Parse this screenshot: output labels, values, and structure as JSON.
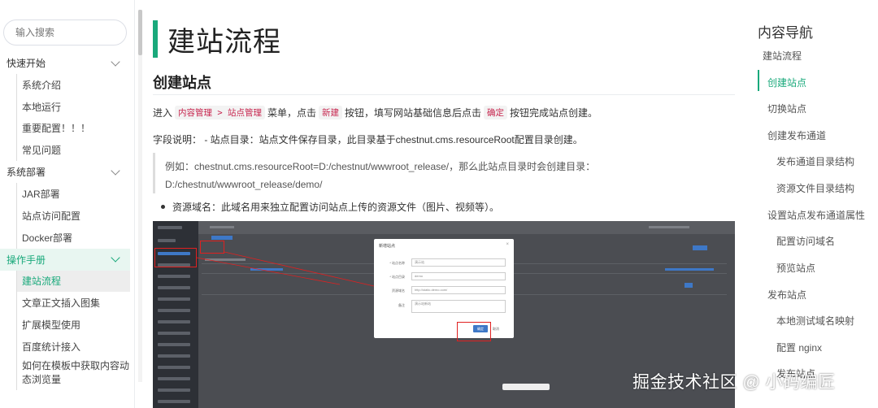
{
  "sidebar": {
    "search_placeholder": "输入搜索",
    "groups": [
      {
        "label": "快速开始",
        "items": [
          "系统介绍",
          "本地运行",
          "重要配置！！！",
          "常见问题"
        ]
      },
      {
        "label": "系统部署",
        "items": [
          "JAR部署",
          "站点访问配置",
          "Docker部署"
        ]
      },
      {
        "label": "操作手册",
        "items": [
          "建站流程",
          "文章正文插入图集",
          "扩展模型使用",
          "百度统计接入",
          "如何在模板中获取内容动态浏览量"
        ]
      }
    ]
  },
  "main": {
    "title": "建站流程",
    "section_title": "创建站点",
    "para1": {
      "pre": "进入",
      "code1": "内容管理 > 站点管理",
      "mid1": "菜单，点击",
      "code2": "新建",
      "mid2": "按钮，填写网站基础信息后点击",
      "code3": "确定",
      "post": "按钮完成站点创建。"
    },
    "para2": "字段说明： - 站点目录：站点文件保存目录，此目录基于chestnut.cms.resourceRoot配置目录创建。",
    "quote": "例如：chestnut.cms.resourceRoot=D:/chestnut/wwwroot_release/，那么此站点目录时会创建目录：D:/chestnut/wwwroot_release/demo/",
    "bullet": "资源域名：此域名用来独立配置访问站点上传的资源文件（图片、视频等）。",
    "screenshot": {
      "dialog_title": "新增站点",
      "fields": [
        {
          "label": "* 站点名称",
          "value": "演示站"
        },
        {
          "label": "* 站点目录",
          "value": "demo"
        },
        {
          "label": "资源域名",
          "value": "http://static.demo.com/"
        },
        {
          "label": "备注",
          "value": "演示站新站"
        }
      ],
      "ok_label": "确定",
      "cancel_label": "取消"
    }
  },
  "toc": {
    "title": "内容导航",
    "items": [
      {
        "label": "建站流程",
        "level": 1
      },
      {
        "label": "创建站点",
        "level": 2,
        "active": true
      },
      {
        "label": "切换站点",
        "level": 2
      },
      {
        "label": "创建发布通道",
        "level": 2
      },
      {
        "label": "发布通道目录结构",
        "level": 3
      },
      {
        "label": "资源文件目录结构",
        "level": 3
      },
      {
        "label": "设置站点发布通道属性",
        "level": 2
      },
      {
        "label": "配置访问域名",
        "level": 3
      },
      {
        "label": "预览站点",
        "level": 3
      },
      {
        "label": "发布站点",
        "level": 2
      },
      {
        "label": "本地测试域名映射",
        "level": 3
      },
      {
        "label": "配置 nginx",
        "level": 3
      },
      {
        "label": "发布站点",
        "level": 3
      }
    ]
  },
  "watermark": "掘金技术社区 @ 小码编匠",
  "colors": {
    "accent": "#19a97b",
    "code_text": "#c7254e"
  }
}
